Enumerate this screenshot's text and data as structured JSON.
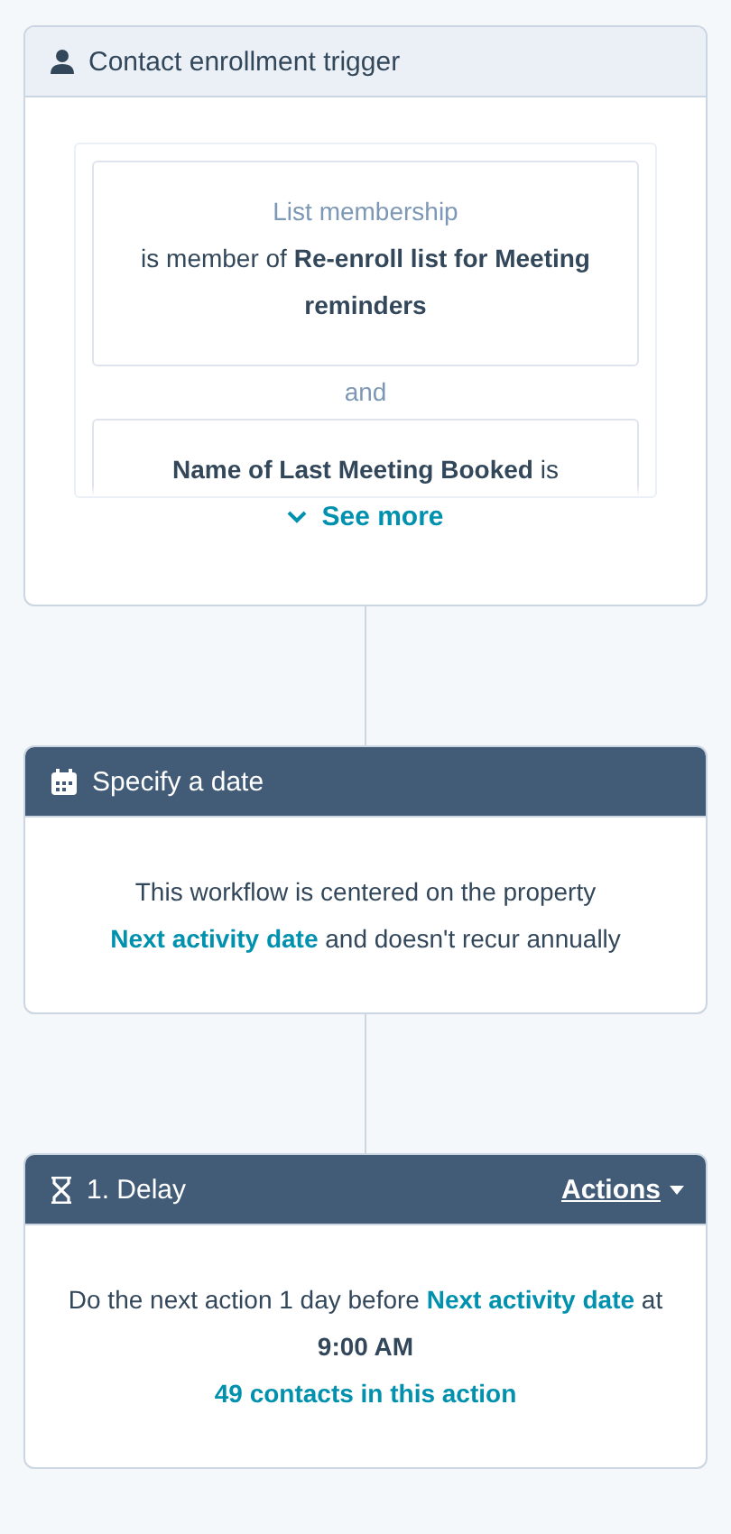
{
  "trigger_card": {
    "title": "Contact enrollment trigger",
    "filters": [
      {
        "label": "List membership",
        "text": "is member of **Re-enroll list for Meeting reminders**"
      },
      {
        "text": "**Name of Last Meeting Booked** is"
      }
    ],
    "joiner": "and",
    "see_more": "See more"
  },
  "steps": [
    {
      "kind": "date",
      "title": "Specify a date",
      "before": "This workflow is centered on the property ",
      "link": "Next activity date",
      "after": " and doesn't recur annually"
    },
    {
      "kind": "delay",
      "title": "1. Delay",
      "menu": "Actions",
      "before": "Do the next action 1 day before ",
      "link": "Next activity date",
      "after": " at **9:00 AM**",
      "footer_link": "49 contacts in this action"
    }
  ]
}
